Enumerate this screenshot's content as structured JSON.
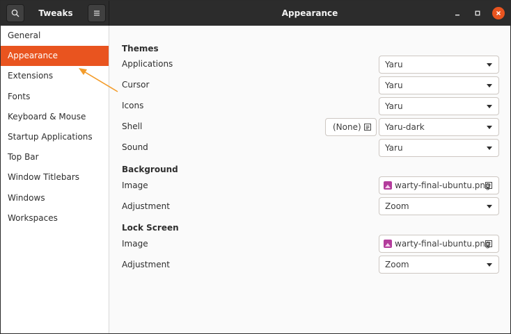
{
  "header": {
    "app_title": "Tweaks",
    "page_title": "Appearance"
  },
  "sidebar": {
    "items": [
      {
        "label": "General"
      },
      {
        "label": "Appearance",
        "active": true
      },
      {
        "label": "Extensions"
      },
      {
        "label": "Fonts"
      },
      {
        "label": "Keyboard & Mouse"
      },
      {
        "label": "Startup Applications"
      },
      {
        "label": "Top Bar"
      },
      {
        "label": "Window Titlebars"
      },
      {
        "label": "Windows"
      },
      {
        "label": "Workspaces"
      }
    ]
  },
  "themes": {
    "title": "Themes",
    "applications": {
      "label": "Applications",
      "value": "Yaru"
    },
    "cursor": {
      "label": "Cursor",
      "value": "Yaru"
    },
    "icons": {
      "label": "Icons",
      "value": "Yaru"
    },
    "shell": {
      "label": "Shell",
      "none_button": "(None)",
      "value": "Yaru-dark"
    },
    "sound": {
      "label": "Sound",
      "value": "Yaru"
    }
  },
  "background": {
    "title": "Background",
    "image": {
      "label": "Image",
      "file": "warty-final-ubuntu.png"
    },
    "adjustment": {
      "label": "Adjustment",
      "value": "Zoom"
    }
  },
  "lock_screen": {
    "title": "Lock Screen",
    "image": {
      "label": "Image",
      "file": "warty-final-ubuntu.png"
    },
    "adjustment": {
      "label": "Adjustment",
      "value": "Zoom"
    }
  },
  "colors": {
    "accent": "#e9541f",
    "header_bg": "#2c2c2c",
    "annotation_arrow": "#f39c2b"
  }
}
